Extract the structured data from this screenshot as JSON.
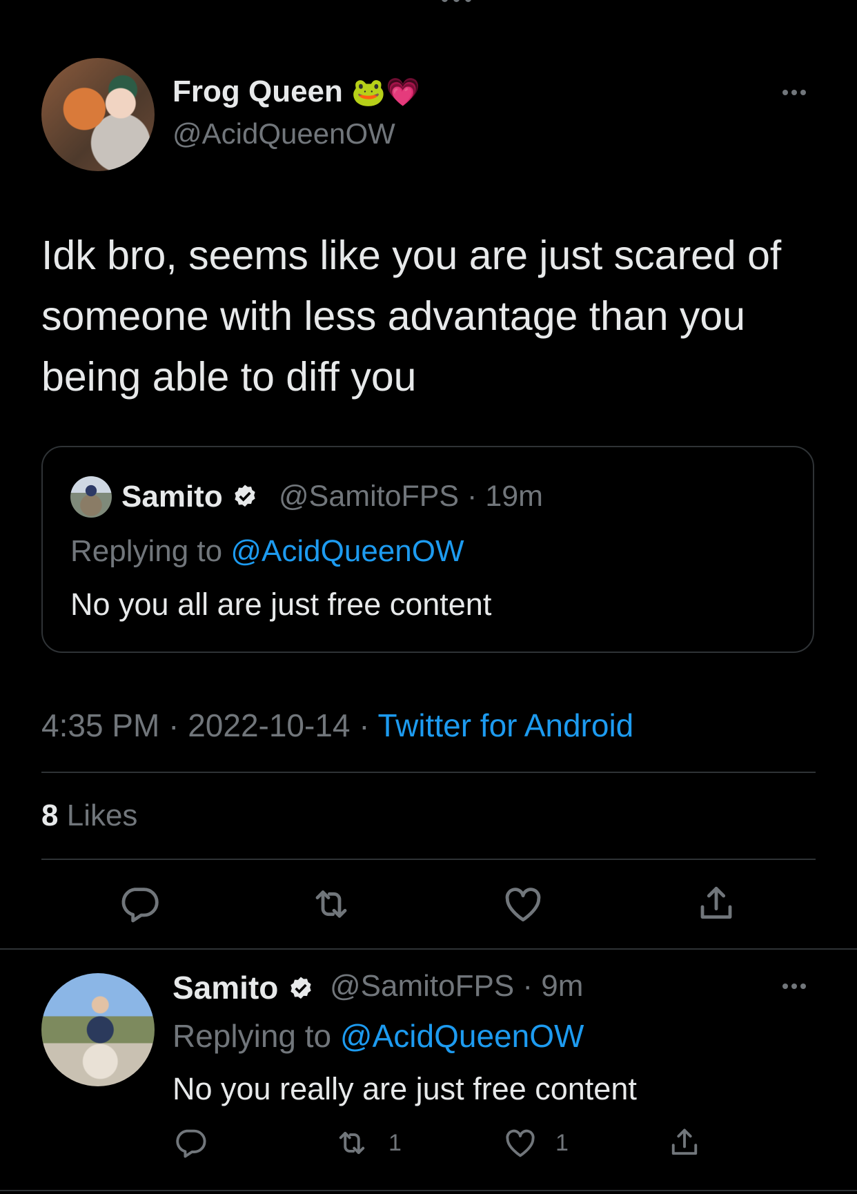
{
  "main_tweet": {
    "display_name": "Frog Queen",
    "name_emojis": [
      "🐸",
      "💗"
    ],
    "handle": "@AcidQueenOW",
    "text": "Idk bro, seems like you are just scared of someone with less advantage than you being able to diff you",
    "timestamp": "4:35 PM · 2022-10-14 · ",
    "source": "Twitter for Android",
    "likes_count": "8",
    "likes_label": "Likes"
  },
  "quoted_tweet": {
    "display_name": "Samito",
    "handle_time": "@SamitoFPS · 19m",
    "replying_prefix": "Replying to ",
    "replying_to": "@AcidQueenOW",
    "text": "No you all are just free content"
  },
  "reply_tweet": {
    "display_name": "Samito",
    "handle_time": "@SamitoFPS · 9m",
    "replying_prefix": "Replying to ",
    "replying_to": "@AcidQueenOW",
    "text": "No you really are just free content",
    "retweet_count": "1",
    "like_count": "1"
  },
  "icons": {
    "reply": "reply-icon",
    "retweet": "retweet-icon",
    "like": "heart-icon",
    "share": "share-icon",
    "more": "more-icon",
    "verified": "verified-badge-icon"
  },
  "colors": {
    "background": "#000000",
    "text": "#e7e9ea",
    "muted": "#71767b",
    "link": "#1d9bf0",
    "border": "#2f3336"
  }
}
